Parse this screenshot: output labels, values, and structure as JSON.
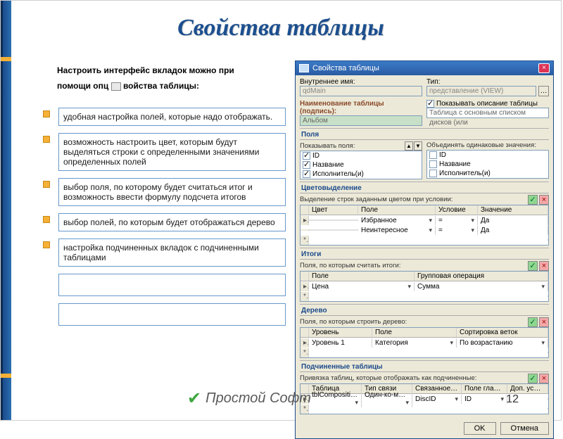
{
  "title": "Свойства таблицы",
  "intro": {
    "line1": "Настроить интерфейс вкладок можно при",
    "line2a": "помощи опц",
    "line2b": "войства таблицы:"
  },
  "bullets": [
    "удобная настройка полей, которые надо отображать.",
    "возможность настроить цвет, которым будут выделяться строки с определенными значениями определенных полей",
    "выбор поля, по которому будет считаться итог и возможность ввести формулу подсчета итогов",
    "выбор полей, по которым будет отображаться дерево",
    "настройка подчиненных вкладок с подчиненными таблицами"
  ],
  "page": "12",
  "footer": "Простой Софт",
  "dlg": {
    "title": "Свойства таблицы",
    "internal_label": "Внутреннее имя:",
    "internal_value": "qdMain",
    "type_label": "Тип:",
    "type_value": "представление (VIEW)",
    "caption_label": "Наименование таблицы (подпись):",
    "caption_value": "Альбом",
    "show_desc": "Показывать описание таблицы",
    "desc_value": "Таблица с основным списком дисков (или",
    "sec_fields": "Поля",
    "fields_show": "Показывать поля:",
    "fields_items": [
      "ID",
      "Название",
      "Исполнитель(и)"
    ],
    "merge_label": "Объединять одинаковые значения:",
    "merge_items": [
      "ID",
      "Название",
      "Исполнитель(и)"
    ],
    "sec_color": "Цветовыделение",
    "color_desc": "Выделение строк заданным цветом при условии:",
    "color_headers": [
      "Цвет",
      "Поле",
      "Условие",
      "Значение"
    ],
    "color_rows": [
      [
        "",
        "Избранное",
        "=",
        "Да"
      ],
      [
        "",
        "Неинтересное",
        "=",
        "Да"
      ]
    ],
    "sec_totals": "Итоги",
    "totals_desc": "Поля, по которым считать итоги:",
    "totals_headers": [
      "Поле",
      "Групповая операция"
    ],
    "totals_rows": [
      [
        "Цена",
        "Сумма"
      ]
    ],
    "sec_tree": "Дерево",
    "tree_desc": "Поля, по которым строить дерево:",
    "tree_headers": [
      "Уровень",
      "Поле",
      "Сортировка веток"
    ],
    "tree_rows": [
      [
        "Уровень 1",
        "Категория",
        "По возрастанию"
      ]
    ],
    "sec_child": "Подчиненные таблицы",
    "child_desc": "Привязка таблиц, которые отображать как подчиненные:",
    "child_headers": [
      "Таблица",
      "Тип связи",
      "Связанное поле",
      "Поле главной..",
      "Доп. условия"
    ],
    "child_rows": [
      [
        "tblComposition",
        "Один-ко-многим",
        "DiscID",
        "ID",
        ""
      ]
    ],
    "ok": "OK",
    "cancel": "Отмена"
  }
}
